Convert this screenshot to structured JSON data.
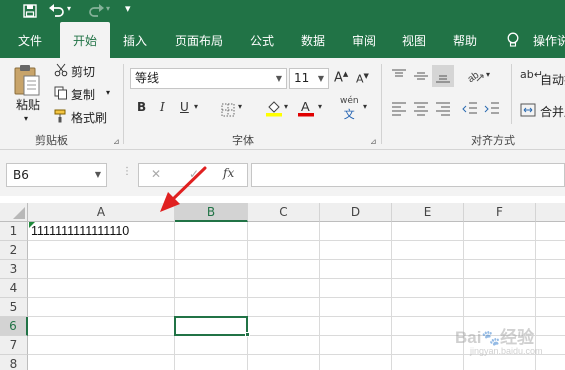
{
  "quick_access": {
    "save_icon": "save-icon",
    "undo_icon": "undo-icon",
    "redo_icon": "redo-icon",
    "customize_icon": "customize-qat-icon"
  },
  "tabs": [
    {
      "label": "文件",
      "active": false
    },
    {
      "label": "开始",
      "active": true
    },
    {
      "label": "插入",
      "active": false
    },
    {
      "label": "页面布局",
      "active": false
    },
    {
      "label": "公式",
      "active": false
    },
    {
      "label": "数据",
      "active": false
    },
    {
      "label": "审阅",
      "active": false
    },
    {
      "label": "视图",
      "active": false
    },
    {
      "label": "帮助",
      "active": false
    }
  ],
  "tell_me": "操作说",
  "clipboard": {
    "paste": "粘贴",
    "cut": "剪切",
    "copy": "复制",
    "format_painter": "格式刷",
    "group_label": "剪贴板"
  },
  "font": {
    "name": "等线",
    "size": "11",
    "bold": "B",
    "italic": "I",
    "underline": "U",
    "group_label": "字体",
    "phonetic_top": "wén",
    "phonetic_bottom": "文"
  },
  "alignment": {
    "wrap": "自动换",
    "merge": "合并后",
    "group_label": "对齐方式"
  },
  "formula_bar": {
    "name_box": "B6",
    "fx": "fx",
    "cancel": "✕",
    "enter": "✓",
    "value": ""
  },
  "sheet": {
    "columns": [
      "A",
      "B",
      "C",
      "D",
      "E",
      "F"
    ],
    "rows": [
      "1",
      "2",
      "3",
      "4",
      "5",
      "6",
      "7",
      "8"
    ],
    "selected_cell": "B6",
    "cells": {
      "A1": "1111111111111110"
    }
  },
  "colors": {
    "ribbon_green": "#217346",
    "highlight_yellow": "#ffff00",
    "font_red": "#e00000",
    "arrow_red": "#e02020"
  }
}
